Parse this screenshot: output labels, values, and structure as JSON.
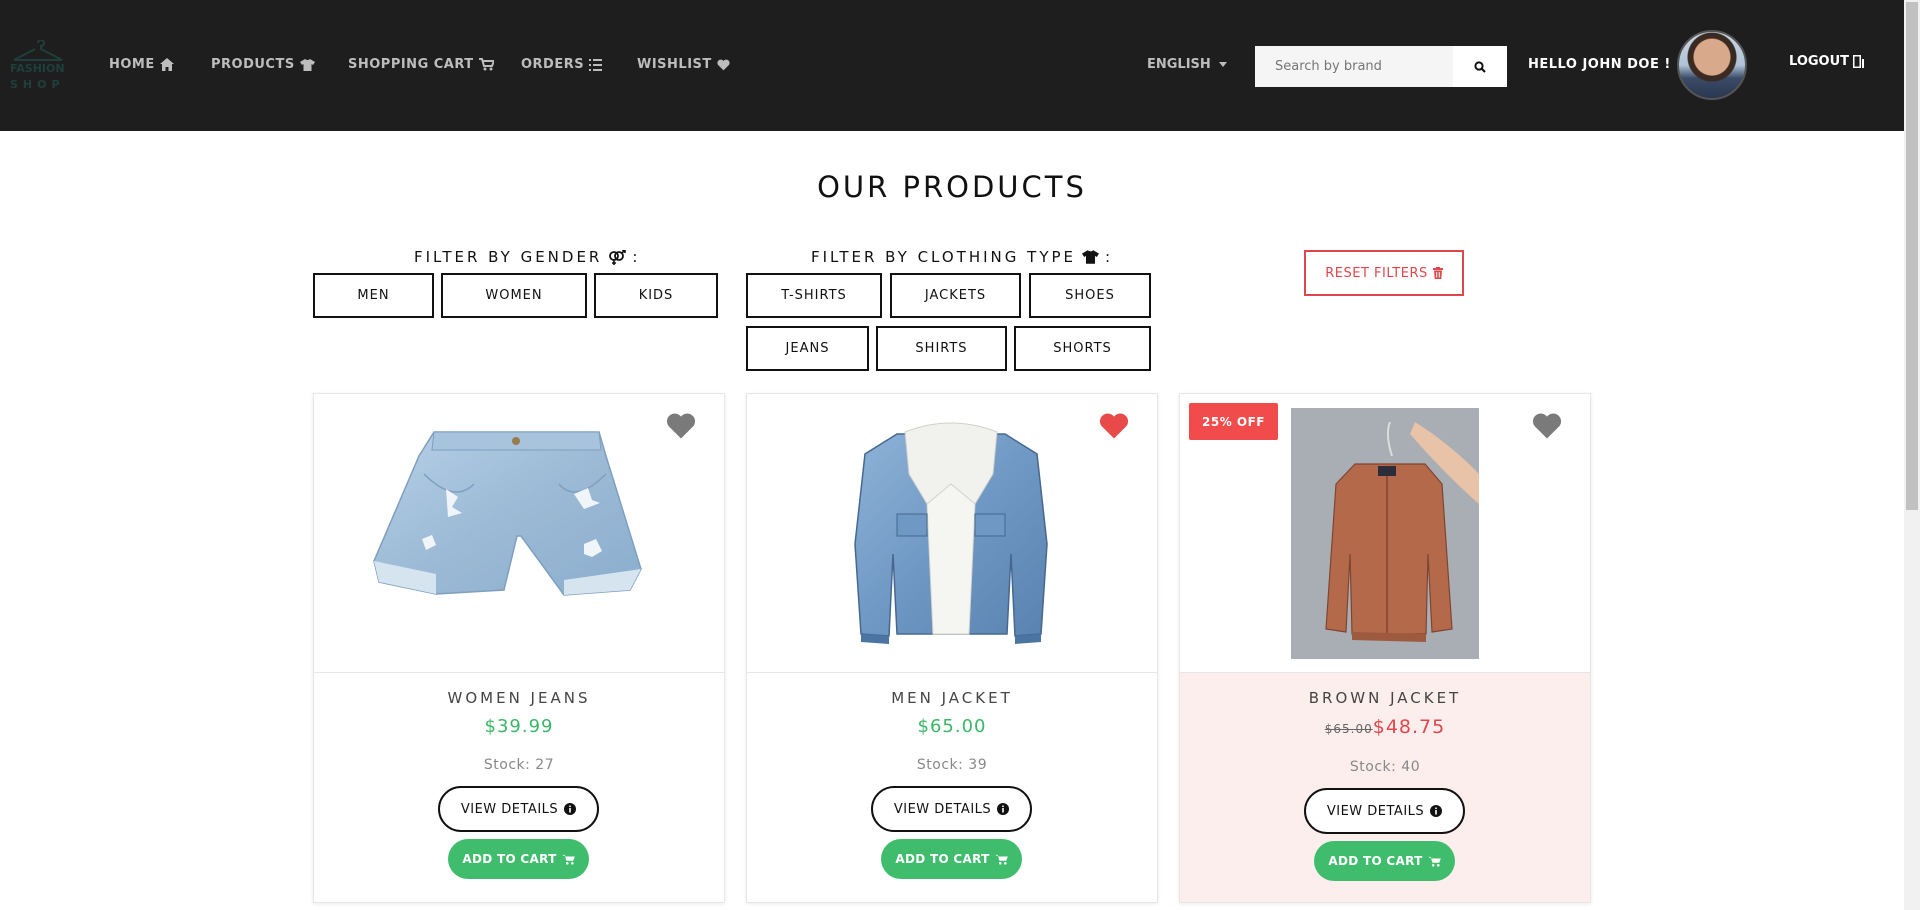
{
  "brand": {
    "logo_line1": "FASHION",
    "logo_line2": "SHOP"
  },
  "nav": {
    "home": "HOME",
    "products": "PRODUCTS",
    "cart": "SHOPPING CART",
    "orders": "ORDERS",
    "wishlist": "WISHLIST"
  },
  "language": "ENGLISH",
  "search": {
    "placeholder": "Search by brand",
    "value": ""
  },
  "user": {
    "greeting": "HELLO JOHN DOE !",
    "logout": "LOGOUT"
  },
  "page_title": "OUR PRODUCTS",
  "filters": {
    "gender_label": "FILTER BY GENDER",
    "gender_options": [
      "MEN",
      "WOMEN",
      "KIDS"
    ],
    "type_label": "FILTER BY CLOTHING TYPE",
    "type_options": [
      "T-SHIRTS",
      "JACKETS",
      "SHOES",
      "JEANS",
      "SHIRTS",
      "SHORTS"
    ],
    "reset": "RESET FILTERS"
  },
  "products": [
    {
      "name": "WOMEN JEANS",
      "price": "$39.99",
      "stock": "Stock: 27",
      "wishlisted": false,
      "view": "VIEW DETAILS",
      "add": "ADD TO CART"
    },
    {
      "name": "MEN JACKET",
      "price": "$65.00",
      "stock": "Stock: 39",
      "wishlisted": true,
      "view": "VIEW DETAILS",
      "add": "ADD TO CART"
    },
    {
      "name": "BROWN JACKET",
      "badge": "25% OFF",
      "old_price": "$65.00",
      "price": "$48.75",
      "stock": "Stock: 40",
      "wishlisted": false,
      "view": "VIEW DETAILS",
      "add": "ADD TO CART"
    }
  ],
  "colors": {
    "navbar": "#1e1e1e",
    "green": "#3fbd6d",
    "red": "#e0474c",
    "heart_active": "#e84a4a",
    "heart_inactive": "#7a7a7a"
  }
}
